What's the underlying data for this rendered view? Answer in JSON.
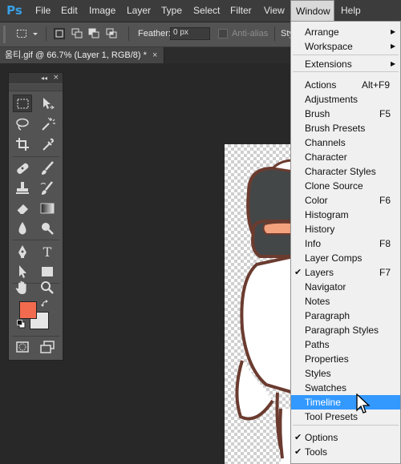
{
  "app": {
    "logo": "Ps"
  },
  "menubar": {
    "items": [
      "File",
      "Edit",
      "Image",
      "Layer",
      "Type",
      "Select",
      "Filter",
      "View",
      "Window",
      "Help"
    ],
    "active": "Window"
  },
  "options_bar": {
    "feather_label": "Feather:",
    "feather_value": "0 px",
    "antialias_label": "Anti-alias",
    "antialias_checked": false,
    "style_label": "Sty"
  },
  "document_tab": {
    "title": "움티.gif @ 66.7% (Layer 1, RGB/8) *",
    "close": "×"
  },
  "tools_panel": {
    "collapse": "◂◂",
    "close": "×",
    "foreground_color": "#f26b4f",
    "background_color": "#e6e6e6"
  },
  "window_menu": {
    "items": [
      {
        "label": "Arrange",
        "submenu": true
      },
      {
        "label": "Workspace",
        "submenu": true
      },
      {
        "label": "Extensions",
        "submenu": true
      },
      {
        "label": "Actions",
        "shortcut": "Alt+F9"
      },
      {
        "label": "Adjustments"
      },
      {
        "label": "Brush",
        "shortcut": "F5"
      },
      {
        "label": "Brush Presets"
      },
      {
        "label": "Channels"
      },
      {
        "label": "Character"
      },
      {
        "label": "Character Styles"
      },
      {
        "label": "Clone Source"
      },
      {
        "label": "Color",
        "shortcut": "F6"
      },
      {
        "label": "Histogram"
      },
      {
        "label": "History"
      },
      {
        "label": "Info",
        "shortcut": "F8"
      },
      {
        "label": "Layer Comps"
      },
      {
        "label": "Layers",
        "shortcut": "F7",
        "checked": true
      },
      {
        "label": "Navigator"
      },
      {
        "label": "Notes"
      },
      {
        "label": "Paragraph"
      },
      {
        "label": "Paragraph Styles"
      },
      {
        "label": "Paths"
      },
      {
        "label": "Properties"
      },
      {
        "label": "Styles"
      },
      {
        "label": "Swatches"
      },
      {
        "label": "Timeline",
        "highlighted": true
      },
      {
        "label": "Tool Presets"
      },
      {
        "label": "Options",
        "checked": true
      },
      {
        "label": "Tools",
        "checked": true
      }
    ],
    "check_glyph": "✔",
    "arrow_glyph": "▶"
  },
  "colors": {
    "menu_highlight": "#3399ff",
    "ui_dark": "#535353",
    "app_bg": "#282828"
  }
}
